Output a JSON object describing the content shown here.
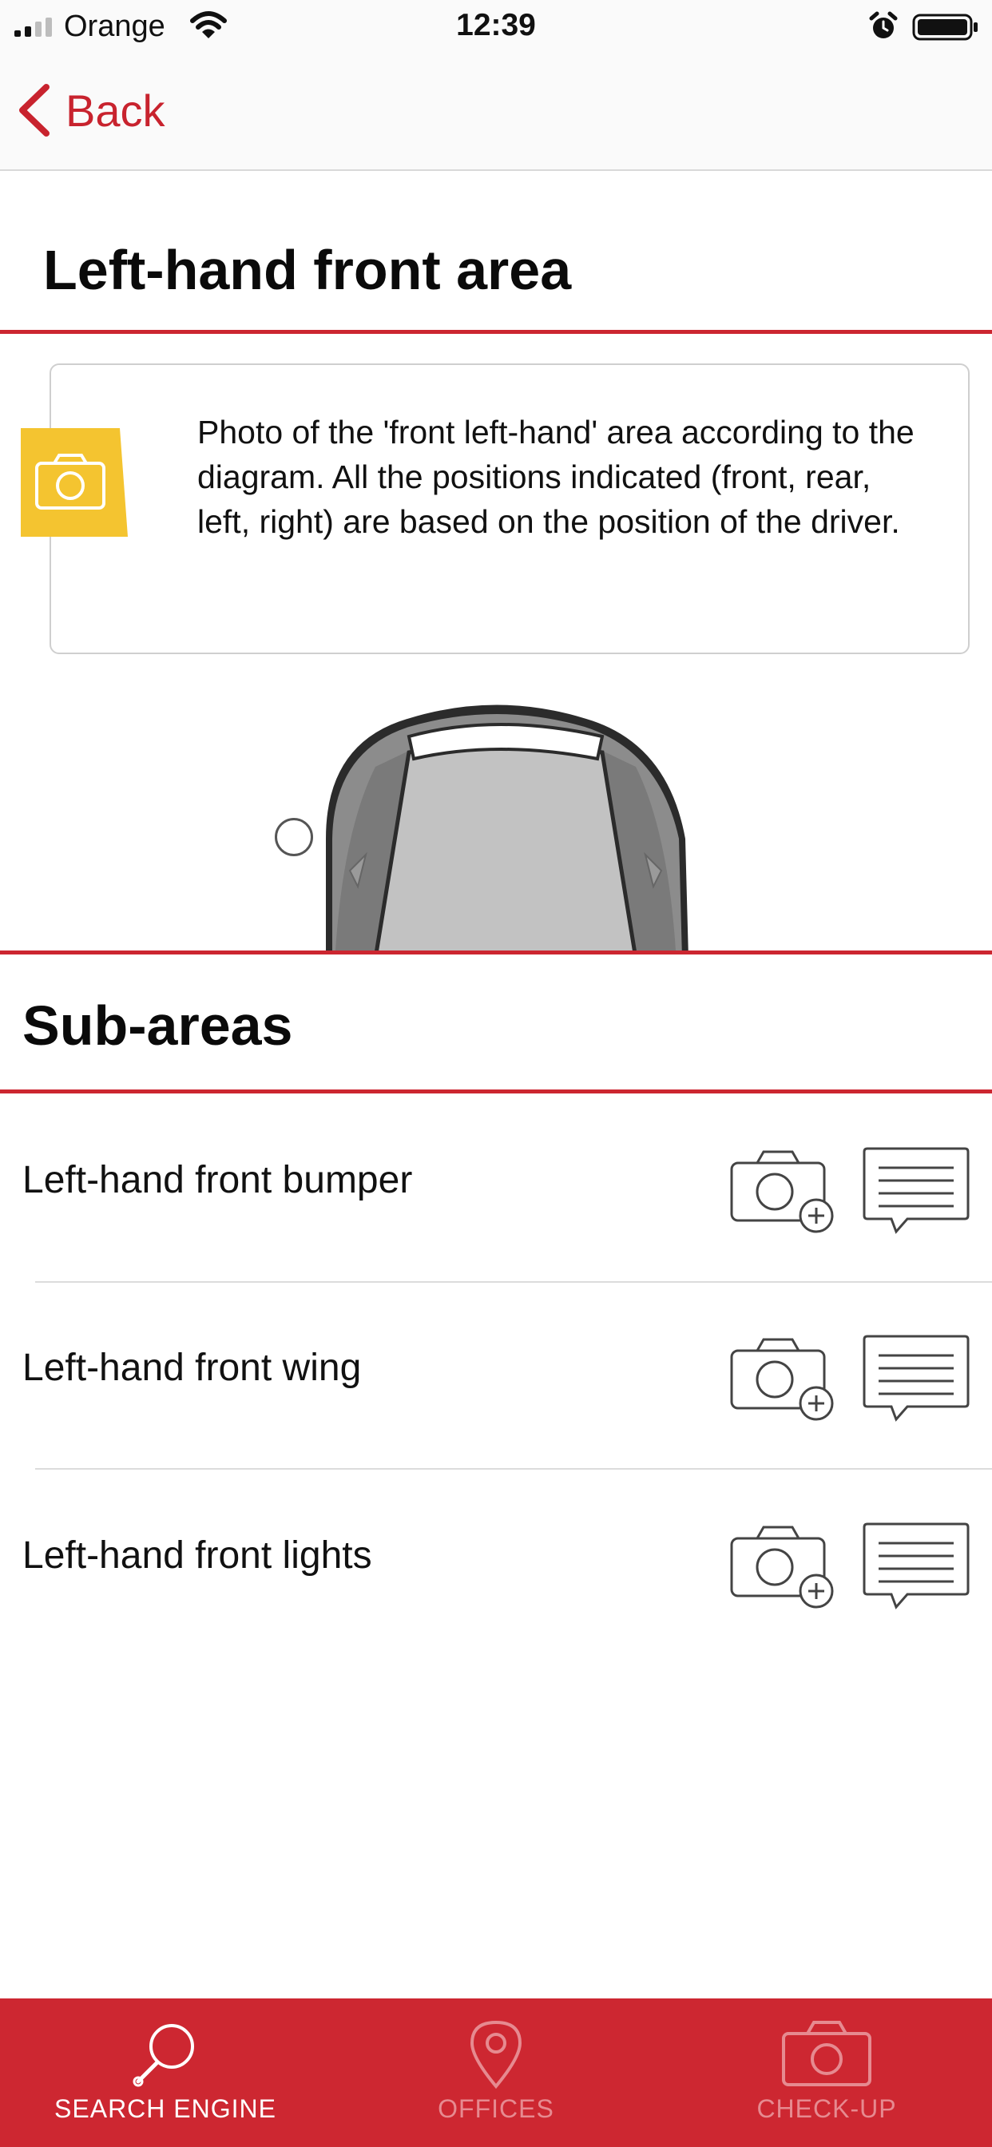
{
  "status_bar": {
    "carrier": "Orange",
    "time": "12:39",
    "icons": [
      "signal-icon",
      "wifi-icon",
      "alarm-icon",
      "battery-icon"
    ]
  },
  "nav": {
    "back_label": "Back",
    "back_icon": "chevron-left-icon"
  },
  "area": {
    "title": "Left-hand front area",
    "info_icon": "camera-icon",
    "info_text": "Photo of the 'front left-hand' area according to the diagram. All the positions indicated (front, rear, left, right) are based on the position of the driver."
  },
  "sub_areas": {
    "title": "Sub-areas",
    "items": [
      {
        "label": "Left-hand front bumper",
        "photo_icon": "camera-add-icon",
        "comment_icon": "comment-icon"
      },
      {
        "label": "Left-hand front wing",
        "photo_icon": "camera-add-icon",
        "comment_icon": "comment-icon"
      },
      {
        "label": "Left-hand front lights",
        "photo_icon": "camera-add-icon",
        "comment_icon": "comment-icon"
      }
    ]
  },
  "tab_bar": {
    "tabs": [
      {
        "label": "SEARCH ENGINE",
        "icon": "search-icon",
        "active": true
      },
      {
        "label": "OFFICES",
        "icon": "location-pin-icon",
        "active": false
      },
      {
        "label": "CHECK-UP",
        "icon": "camera-icon",
        "active": false
      }
    ]
  },
  "colors": {
    "brand_red": "#cc2630",
    "tag_yellow": "#f4c430",
    "tab_active_text": "#ffffff",
    "tab_inactive_text": "#e68a90"
  }
}
